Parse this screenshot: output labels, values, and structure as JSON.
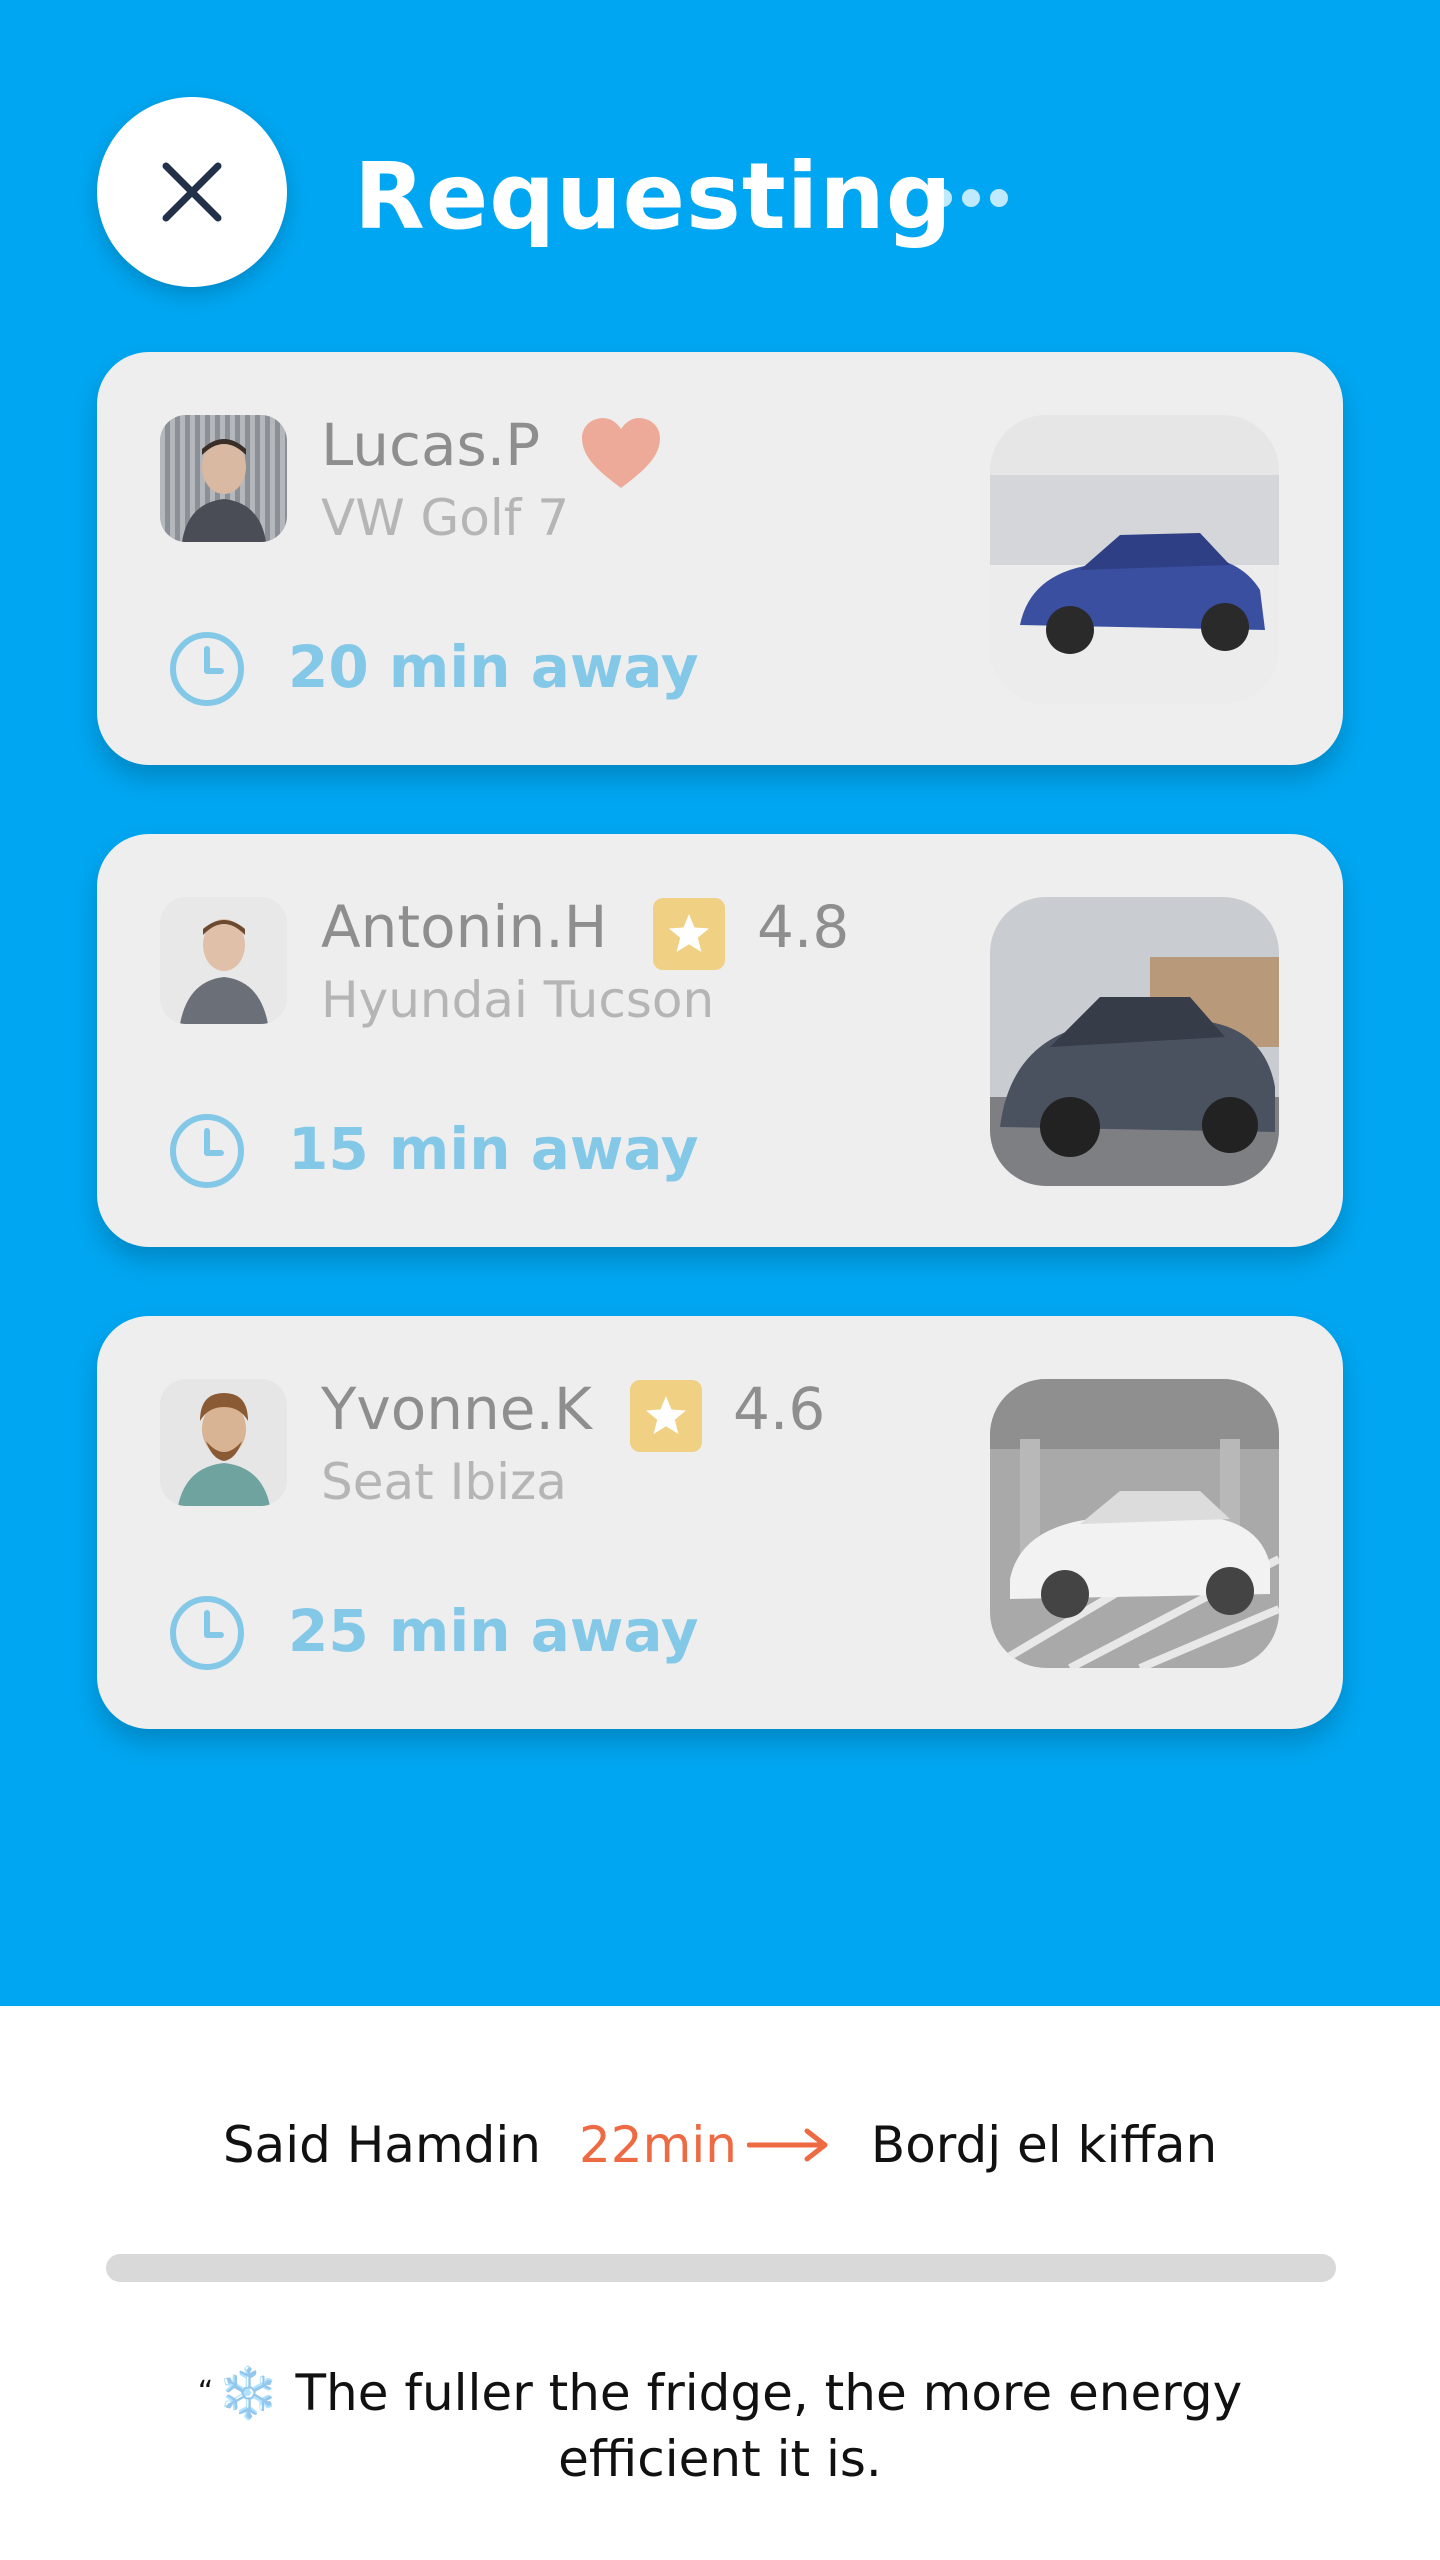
{
  "header": {
    "title": "Requesting"
  },
  "drivers": [
    {
      "name": "Lucas.P",
      "car": "VW Golf 7",
      "badge": "heart-icon",
      "rating": "",
      "eta": "20 min away",
      "car_color": "#3a4fa0"
    },
    {
      "name": "Antonin.H",
      "car": "Hyundai Tucson",
      "badge": "star-icon",
      "rating": "4.8",
      "eta": "15 min away",
      "car_color": "#4a5260"
    },
    {
      "name": "Yvonne.K",
      "car": "Seat Ibiza",
      "badge": "star-icon",
      "rating": "4.6",
      "eta": "25 min away",
      "car_color": "#f2f2f2"
    }
  ],
  "trip": {
    "origin": "Said Hamdin",
    "duration": "22min",
    "destination": "Bordj el kiffan"
  },
  "progress": {
    "value": 0.0
  },
  "tip": {
    "quote_mark": "“",
    "icon": "❄️",
    "text": "The fuller the fridge, the more energy efficient it is."
  },
  "colors": {
    "accent": "#00a6f1",
    "eta_text": "#84c8e8",
    "duration": "#ee6a43",
    "heart": "#eeaa98",
    "star_badge": "#f0d183"
  }
}
